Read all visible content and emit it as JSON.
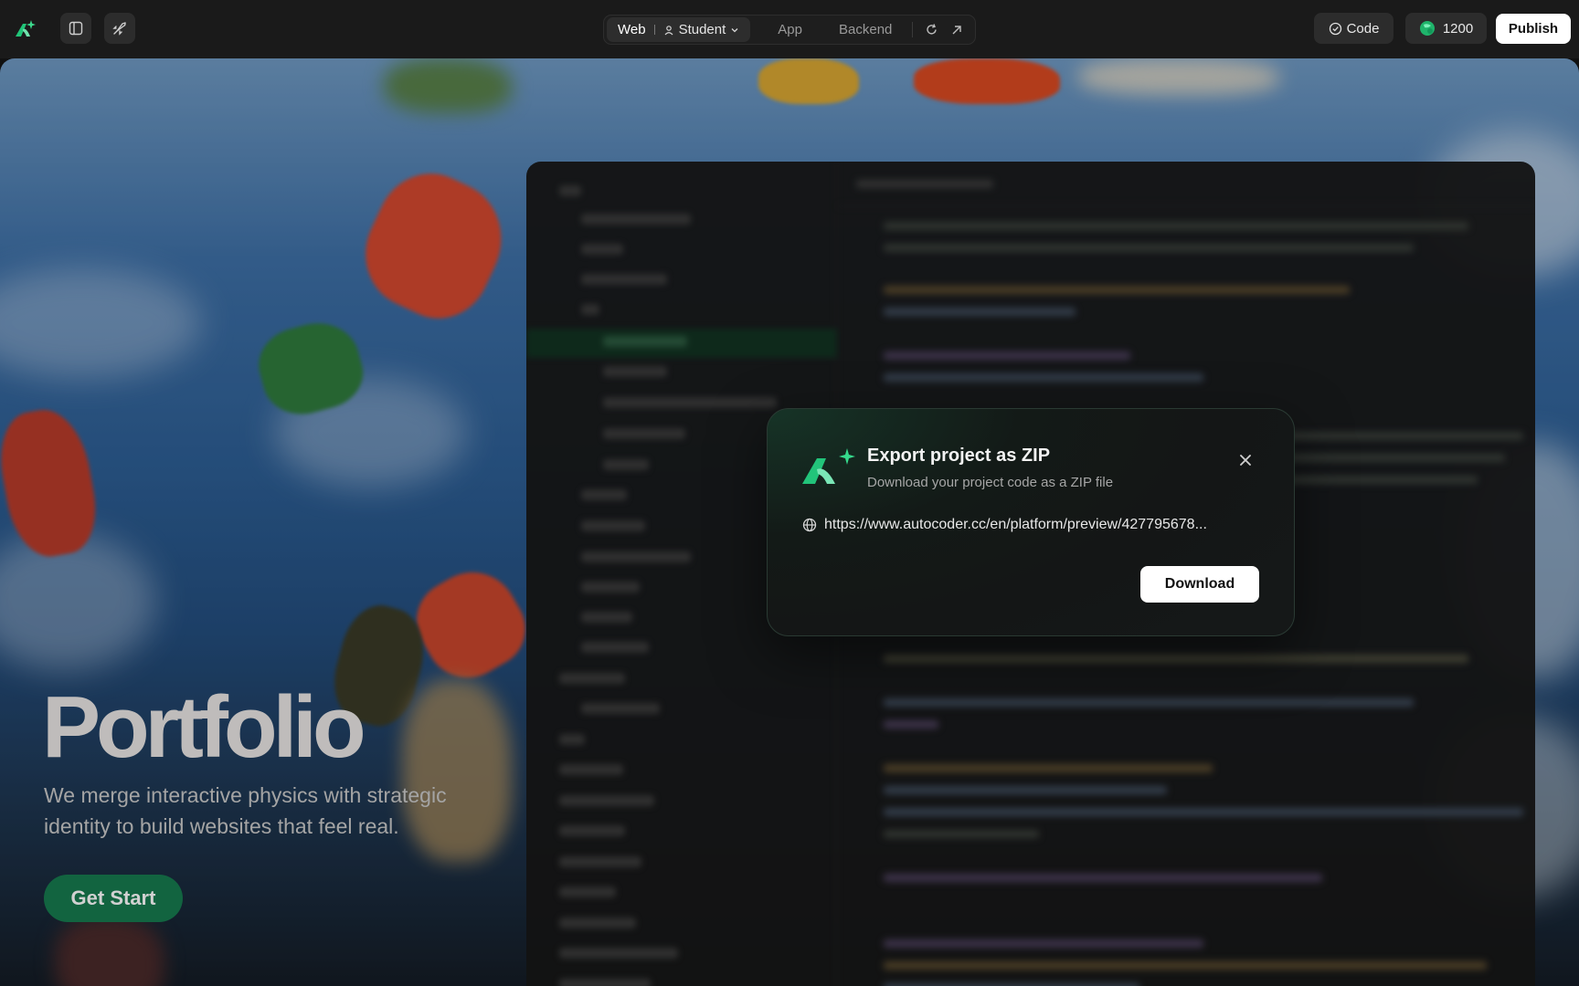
{
  "topbar": {
    "segment": {
      "web_label": "Web",
      "mode_label": "Student",
      "app_label": "App",
      "backend_label": "Backend"
    },
    "code_label": "Code",
    "credits": "1200",
    "publish_label": "Publish"
  },
  "preview": {
    "title": "Portfolio",
    "subtitle": "We merge interactive physics with strategic identity to build websites that feel real.",
    "cta_label": "Get Start"
  },
  "modal": {
    "title": "Export project as ZIP",
    "subtitle": "Download your project code as a ZIP file",
    "url": "https://www.autocoder.cc/en/platform/preview/427795678...",
    "download_label": "Download"
  },
  "icons": [
    "autocoder-logo-icon",
    "sidebar-toggle-icon",
    "rocket-icon",
    "user-icon",
    "chevron-down-icon",
    "refresh-icon",
    "external-link-icon",
    "check-circle-icon",
    "coin-icon",
    "close-icon",
    "globe-icon"
  ],
  "colors": {
    "brand_green": "#20c777",
    "cta_green": "#167a4f",
    "publish_bg": "#ffffff"
  }
}
